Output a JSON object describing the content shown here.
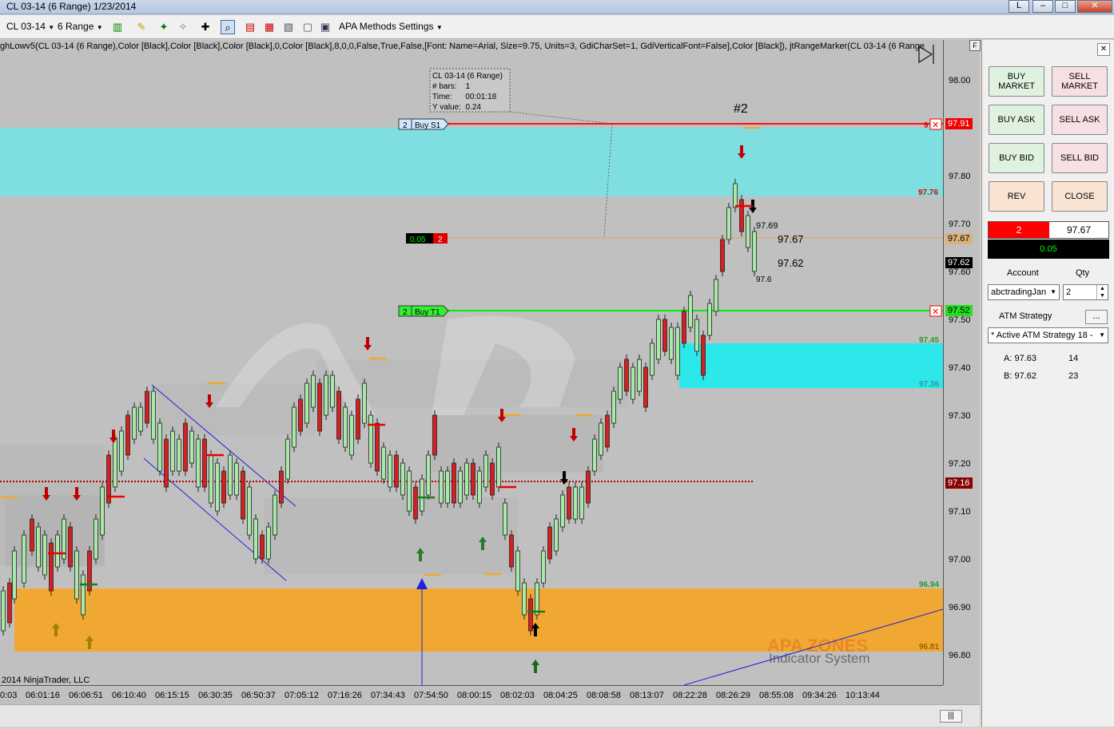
{
  "window": {
    "title": "CL 03-14 (6 Range)  1/23/2014",
    "btn_restore": "L",
    "btn_minimize": "–",
    "btn_maximize": "□",
    "btn_close": "✕"
  },
  "toolbar": {
    "instrument": "CL 03-14",
    "period": "6 Range",
    "strategy_menu": "APA Methods Settings"
  },
  "indicator_line": "ghLowv5(CL 03-14 (6 Range),Color [Black],Color [Black],Color [Black],0,Color [Black],8,0,0,False,True,False,[Font: Name=Arial, Size=9.75, Units=3, GdiCharSet=1, GdiVerticalFont=False],Color [Black]), jtRangeMarker(CL 03-14 (6 Range",
  "copyright": "2014 NinjaTrader, LLC",
  "watermark": {
    "brand": "APA ZONES",
    "tagline": "Indicator System"
  },
  "tooltip": {
    "line1": "CL 03-14 (6 Range)",
    "line2": "# bars:    1",
    "line3": "Time:      00:01:18",
    "line4": "Y value:  0.24"
  },
  "orders": {
    "stop": {
      "qty": "2",
      "label": "Buy  S1",
      "price": "97.91"
    },
    "target": {
      "qty": "2",
      "label": "Buy  T1",
      "price": "97.52"
    },
    "pnl_marker": {
      "value": "0.05",
      "qty": "2"
    }
  },
  "annotations": {
    "signal": "#2",
    "p9769": "97.69",
    "p9767": "97.67",
    "p9762": "97.62",
    "p976": "97.6"
  },
  "zone_labels": {
    "z9776": "97.76",
    "z9745": "97.45",
    "z9736": "97.36",
    "z9694": "96.94",
    "z9681": "96.81",
    "stop_partial": "9"
  },
  "price_axis": {
    "ticks": [
      "98.00",
      "97.80",
      "97.70",
      "97.60",
      "97.50",
      "97.40",
      "97.30",
      "97.20",
      "97.10",
      "97.00",
      "96.90",
      "96.80"
    ],
    "tag_stop": "97.91",
    "tag_entry": "97.67",
    "tag_last": "97.62",
    "tag_target": "97.52",
    "tag_ma": "97.16"
  },
  "time_axis": [
    "0:03",
    "06:01:16",
    "06:06:51",
    "06:10:40",
    "06:15:15",
    "06:30:35",
    "06:50:37",
    "07:05:12",
    "07:16:26",
    "07:34:43",
    "07:54:50",
    "08:00:15",
    "08:02:03",
    "08:04:25",
    "08:08:58",
    "08:13:07",
    "08:22:28",
    "08:26:29",
    "08:55:08",
    "09:34:26",
    "10:13:44"
  ],
  "panel": {
    "buy_market": "BUY\nMARKET",
    "sell_market": "SELL\nMARKET",
    "buy_ask": "BUY ASK",
    "sell_ask": "SELL ASK",
    "buy_bid": "BUY BID",
    "sell_bid": "SELL BID",
    "rev": "REV",
    "close": "CLOSE",
    "position_qty": "2",
    "position_price": "97.67",
    "pnl": "0.05",
    "account_label": "Account",
    "qty_label": "Qty",
    "account_value": "abctradingJan",
    "qty_value": "2",
    "atm_label": "ATM Strategy",
    "atm_button": "...",
    "atm_value": "* Active ATM Strategy 18 -",
    "ask_label": "A: 97.63",
    "ask_size": "14",
    "bid_label": "B: 97.62",
    "bid_size": "23",
    "close_icon": "✕",
    "f_button": "F"
  },
  "scroll": {
    "thumb": "|||"
  },
  "colors": {
    "chart_bg": "#c0c0c0",
    "supply_zone": "#7fdfe0",
    "demand_zone": "#f1a832",
    "up_candle": "#a8e8a8",
    "down_candle": "#d32020",
    "stop_line": "#ff0000",
    "target_line": "#00ff00",
    "ma_line": "#b00000"
  }
}
